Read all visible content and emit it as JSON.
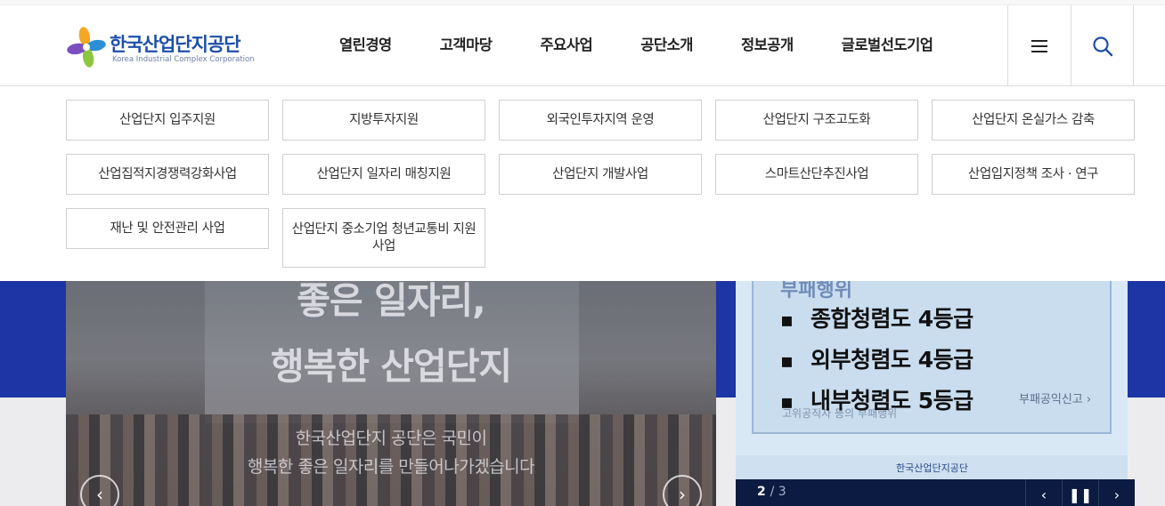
{
  "logo": {
    "name": "한국산업단지공단",
    "eng": "Korea Industrial Complex Corporation"
  },
  "gnb": [
    "열린경영",
    "고객마당",
    "주요사업",
    "공단소개",
    "정보공개",
    "글로벌선도기업"
  ],
  "submenu": [
    "산업단지 입주지원",
    "지방투자지원",
    "외국인투자지역 운영",
    "산업단지 구조고도화",
    "산업단지 온실가스 감축",
    "산업집적지경쟁력강화사업",
    "산업단지 일자리 매칭지원",
    "산업단지 개발사업",
    "스마트산단추진사업",
    "산업입지정책 조사 · 연구",
    "재난 및 안전관리 사업",
    "산업단지 중소기업 청년교통비 지원 사업"
  ],
  "hero": {
    "title_line1": "좋은 일자리,",
    "title_line2": "행복한 산업단지",
    "sub_line1": "한국산업단지 공단은 국민이",
    "sub_line2": "행복한 좋은 일자리를 만들어나가겠습니다"
  },
  "banner": {
    "heading": "부패행위",
    "items": [
      "종합청렴도  4등급",
      "외부청렴도  4등급",
      "내부청렴도  5등급"
    ],
    "link": "부패공익신고 ›",
    "faded": "고위공직자 등의 부패행위",
    "logo": "한국산업단지공단",
    "current": "2",
    "total": "/ 3"
  },
  "icons": {
    "menu": "hamburger-menu-icon",
    "search": "search-icon",
    "prev": "chevron-left-icon",
    "pause": "pause-icon",
    "next": "chevron-right-icon"
  },
  "colors": {
    "brand": "#1f4fa8",
    "hero_band": "#1d35a5",
    "control_bar": "#0c1b42"
  }
}
